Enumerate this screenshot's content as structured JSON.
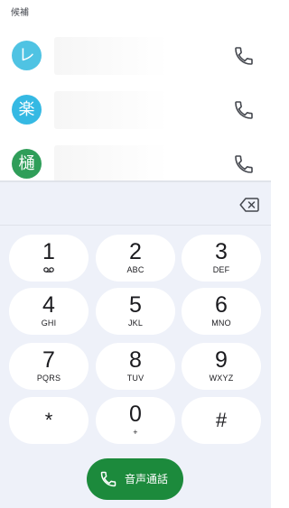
{
  "suggestions": {
    "label": "候補",
    "contacts": [
      {
        "initial": "レ",
        "avatar_color": "#4fc3e3",
        "icon": "phone-icon"
      },
      {
        "initial": "楽",
        "avatar_color": "#35b9e3",
        "icon": "phone-icon"
      },
      {
        "initial": "樋",
        "avatar_color": "#2f9e59",
        "icon": "phone-icon"
      }
    ]
  },
  "dialer": {
    "digits_value": "",
    "backspace_icon": "backspace-icon",
    "keys": [
      {
        "digit": "1",
        "letters": "",
        "icon": "voicemail-icon"
      },
      {
        "digit": "2",
        "letters": "ABC"
      },
      {
        "digit": "3",
        "letters": "DEF"
      },
      {
        "digit": "4",
        "letters": "GHI"
      },
      {
        "digit": "5",
        "letters": "JKL"
      },
      {
        "digit": "6",
        "letters": "MNO"
      },
      {
        "digit": "7",
        "letters": "PQRS"
      },
      {
        "digit": "8",
        "letters": "TUV"
      },
      {
        "digit": "9",
        "letters": "WXYZ"
      },
      {
        "digit": "*",
        "letters": ""
      },
      {
        "digit": "0",
        "letters": "+"
      },
      {
        "digit": "#",
        "letters": ""
      }
    ],
    "call_button": {
      "label": "音声通話",
      "icon": "phone-icon",
      "color": "#1c8a3c"
    }
  },
  "colors": {
    "dialer_bg": "#eef1f9",
    "key_bg": "#ffffff",
    "text": "#1b1b1f"
  }
}
